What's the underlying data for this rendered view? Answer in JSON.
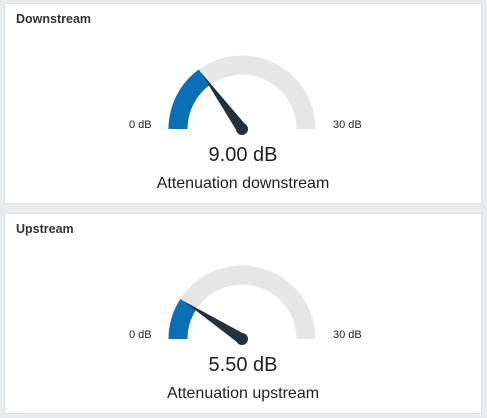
{
  "widgets": [
    {
      "title": "Downstream",
      "value": 9.0,
      "min": 0,
      "max": 30,
      "unit": "dB",
      "min_label": "0 dB",
      "max_label": "30 dB",
      "value_label": "9.00 dB",
      "description": "Attenuation downstream"
    },
    {
      "title": "Upstream",
      "value": 5.5,
      "min": 0,
      "max": 30,
      "unit": "dB",
      "min_label": "0 dB",
      "max_label": "30 dB",
      "value_label": "5.50 dB",
      "description": "Attenuation upstream"
    }
  ],
  "colors": {
    "fill": "#0a6fb5",
    "track": "#e6e6e6",
    "needle": "#24303a"
  }
}
